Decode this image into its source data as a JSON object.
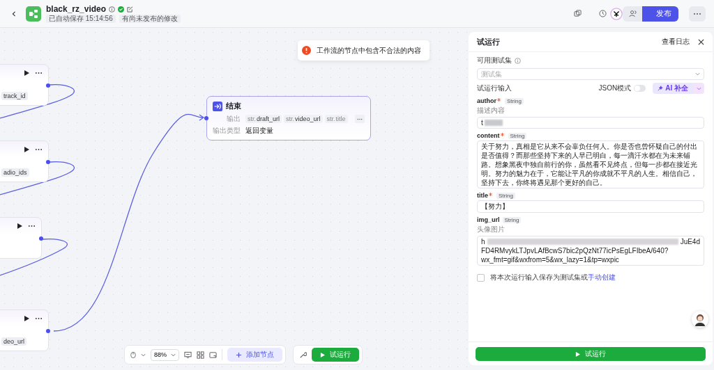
{
  "header": {
    "title": "black_rz_video",
    "published": true,
    "autosave": "已自动保存 15:14:56",
    "unpublished_note": "有尚未发布的修改",
    "publish_button": "发布"
  },
  "canvas": {
    "toast": "工作流的节点中包含不合法的内容",
    "nodes": [
      {
        "tag": "track_id",
        "selected": false
      },
      {
        "tag": "adio_ids",
        "selected": false
      },
      {
        "selected": false
      },
      {
        "tag": "deo_url",
        "selected": false
      }
    ],
    "end_node": {
      "title": "结束",
      "output_label": "输出",
      "outputs": [
        {
          "prefix": "str.",
          "name": "draft_url",
          "faded": false
        },
        {
          "prefix": "str.",
          "name": "video_url",
          "faded": false
        },
        {
          "prefix": "str.",
          "name": "title",
          "faded": true
        }
      ],
      "type_label": "输出类型",
      "type_value": "返回变量"
    },
    "toolbar": {
      "zoom": "88%",
      "add_node": "添加节点",
      "run": "试运行"
    }
  },
  "panel": {
    "title": "试运行",
    "log_link": "查看日志",
    "testset_label": "可用测试集",
    "testset_placeholder": "测试集",
    "input_label": "试运行输入",
    "json_mode": {
      "label": "JSON模式",
      "on": false
    },
    "ai_button": "AI 补全",
    "fields": [
      {
        "kind": "input",
        "name": "author",
        "required": true,
        "type": "String",
        "description": "描述内容",
        "value": "t"
      },
      {
        "kind": "textarea",
        "name": "content",
        "required": true,
        "type": "String",
        "value": "关于努力，真相是它从来不会辜负任何人。你是否也曾怀疑自己的付出是否值得？而那些坚持下来的人早已明白，每一滴汗水都在为未来铺路。想象黑夜中独自前行的你，虽然看不见终点，但每一步都在接近光明。努力的魅力在于，它能让平凡的你成就不平凡的人生。相信自己，坚持下去，你终将遇见那个更好的自己。"
      },
      {
        "kind": "input",
        "name": "title",
        "required": true,
        "type": "String",
        "value": "【努力】"
      },
      {
        "kind": "url",
        "name": "img_url",
        "required": false,
        "type": "String",
        "description": "头像图片",
        "start": "h",
        "end": "JuE4d",
        "lines": [
          "FD4RMvykLTJpvLAfBcwS7bic2pQzNt77icPsEgLFIbeA/640?",
          "wx_fmt=gif&wxfrom=5&wx_lazy=1&tp=wxpic"
        ]
      }
    ],
    "save": {
      "checked": false,
      "text": "将本次运行输入保存为测试集或",
      "link": "手动创建"
    },
    "run_button": "试运行"
  }
}
